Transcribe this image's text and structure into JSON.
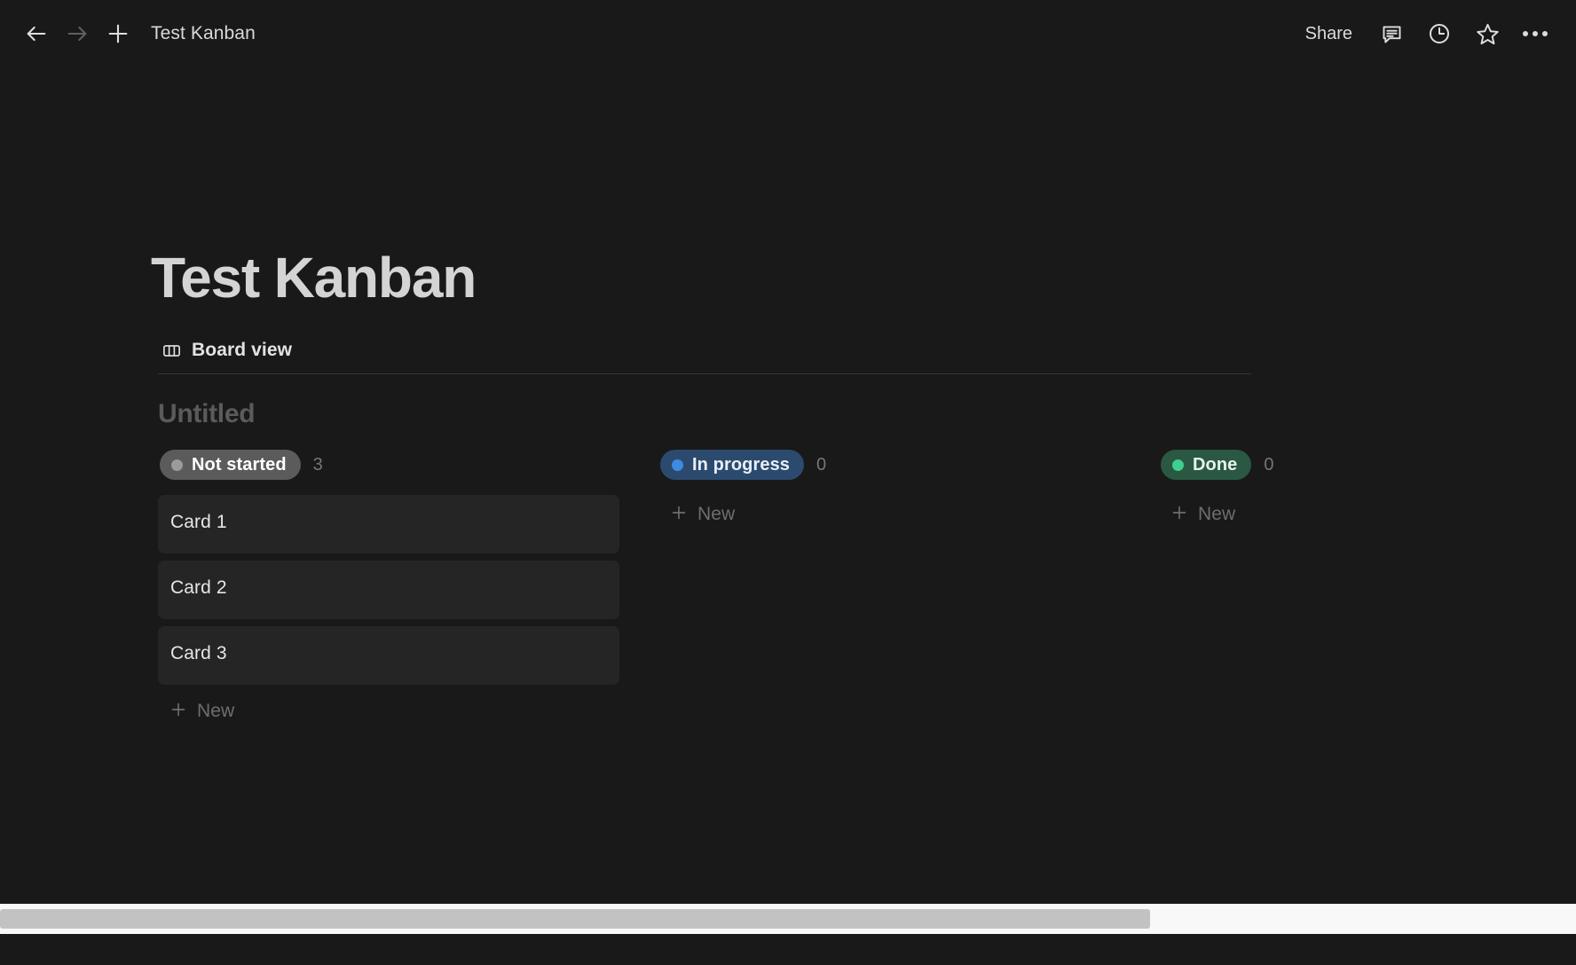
{
  "window": {
    "title": "Test Kanban"
  },
  "topbar": {
    "back_icon": "arrow-left-icon",
    "forward_icon": "arrow-right-icon",
    "add_icon": "plus-icon",
    "breadcrumb_title": "Test Kanban",
    "share_label": "Share",
    "comment_icon": "comment-icon",
    "history_icon": "clock-history-icon",
    "favorite_icon": "star-icon",
    "more_icon": "more-horizontal-icon"
  },
  "page": {
    "title": "Test Kanban",
    "view_tab": {
      "label": "Board view",
      "icon": "board-view-icon",
      "active": true
    },
    "group_title": "Untitled"
  },
  "board": {
    "new_label": "New",
    "new_icon": "plus-icon",
    "columns": [
      {
        "status": "Not started",
        "count": "3",
        "chip_bg": "#5b5b5b",
        "chip_text": "#ffffff",
        "dot_color": "#9b9b9b",
        "cards": [
          {
            "title": "Card 1"
          },
          {
            "title": "Card 2"
          },
          {
            "title": "Card 3"
          }
        ]
      },
      {
        "status": "In progress",
        "count": "0",
        "chip_bg": "#2c4a6e",
        "chip_text": "#e8eef7",
        "dot_color": "#3c8ce0",
        "cards": []
      },
      {
        "status": "Done",
        "count": "0",
        "chip_bg": "#2a5843",
        "chip_text": "#e7f3ec",
        "dot_color": "#3fcf8e",
        "cards": []
      }
    ]
  },
  "scrollbar": {
    "orientation": "horizontal",
    "thumb_width_percent": 73,
    "track_color": "#f8f8f8",
    "thumb_color": "#c2c2c2"
  },
  "theme": {
    "background": "#191919",
    "card_background": "#252525",
    "text_primary": "#d4d4d4",
    "text_muted": "#6e6e6e",
    "divider": "#373737"
  }
}
